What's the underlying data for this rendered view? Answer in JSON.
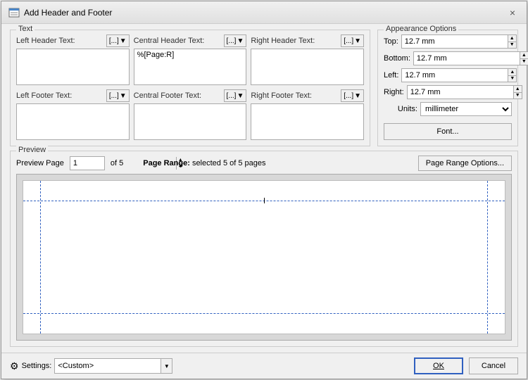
{
  "dialog": {
    "title": "Add Header and Footer",
    "close_label": "×"
  },
  "text_section": {
    "label": "Text",
    "left_header": {
      "label": "Left Header Text:",
      "value": "",
      "insert_label": "[...]",
      "placeholder": ""
    },
    "central_header": {
      "label": "Central Header Text:",
      "value": "%[Page:R]",
      "insert_label": "[...]",
      "placeholder": ""
    },
    "right_header": {
      "label": "Right Header Text:",
      "value": "",
      "insert_label": "[...]",
      "placeholder": ""
    },
    "left_footer": {
      "label": "Left Footer Text:",
      "value": "",
      "insert_label": "[...]",
      "placeholder": ""
    },
    "central_footer": {
      "label": "Central Footer Text:",
      "value": "",
      "insert_label": "[...]",
      "placeholder": ""
    },
    "right_footer": {
      "label": "Right Footer Text:",
      "value": "",
      "insert_label": "[...]",
      "placeholder": ""
    }
  },
  "appearance": {
    "label": "Appearance Options",
    "top_label": "Top:",
    "top_value": "12.7 mm",
    "bottom_label": "Bottom:",
    "bottom_value": "12.7 mm",
    "left_label": "Left:",
    "left_value": "12.7 mm",
    "right_label": "Right:",
    "right_value": "12.7 mm",
    "units_label": "Units:",
    "units_value": "millimeter",
    "font_btn": "Font..."
  },
  "preview": {
    "label": "Preview",
    "page_label": "Preview Page",
    "page_value": "1",
    "of_label": "of 5",
    "range_label": "Page Range:",
    "range_value": "selected 5 of 5 pages",
    "range_btn": "Page Range Options..."
  },
  "bottom": {
    "settings_icon": "⚙",
    "settings_label": "Settings:",
    "settings_value": "<Custom>",
    "ok_label": "OK",
    "cancel_label": "Cancel"
  }
}
